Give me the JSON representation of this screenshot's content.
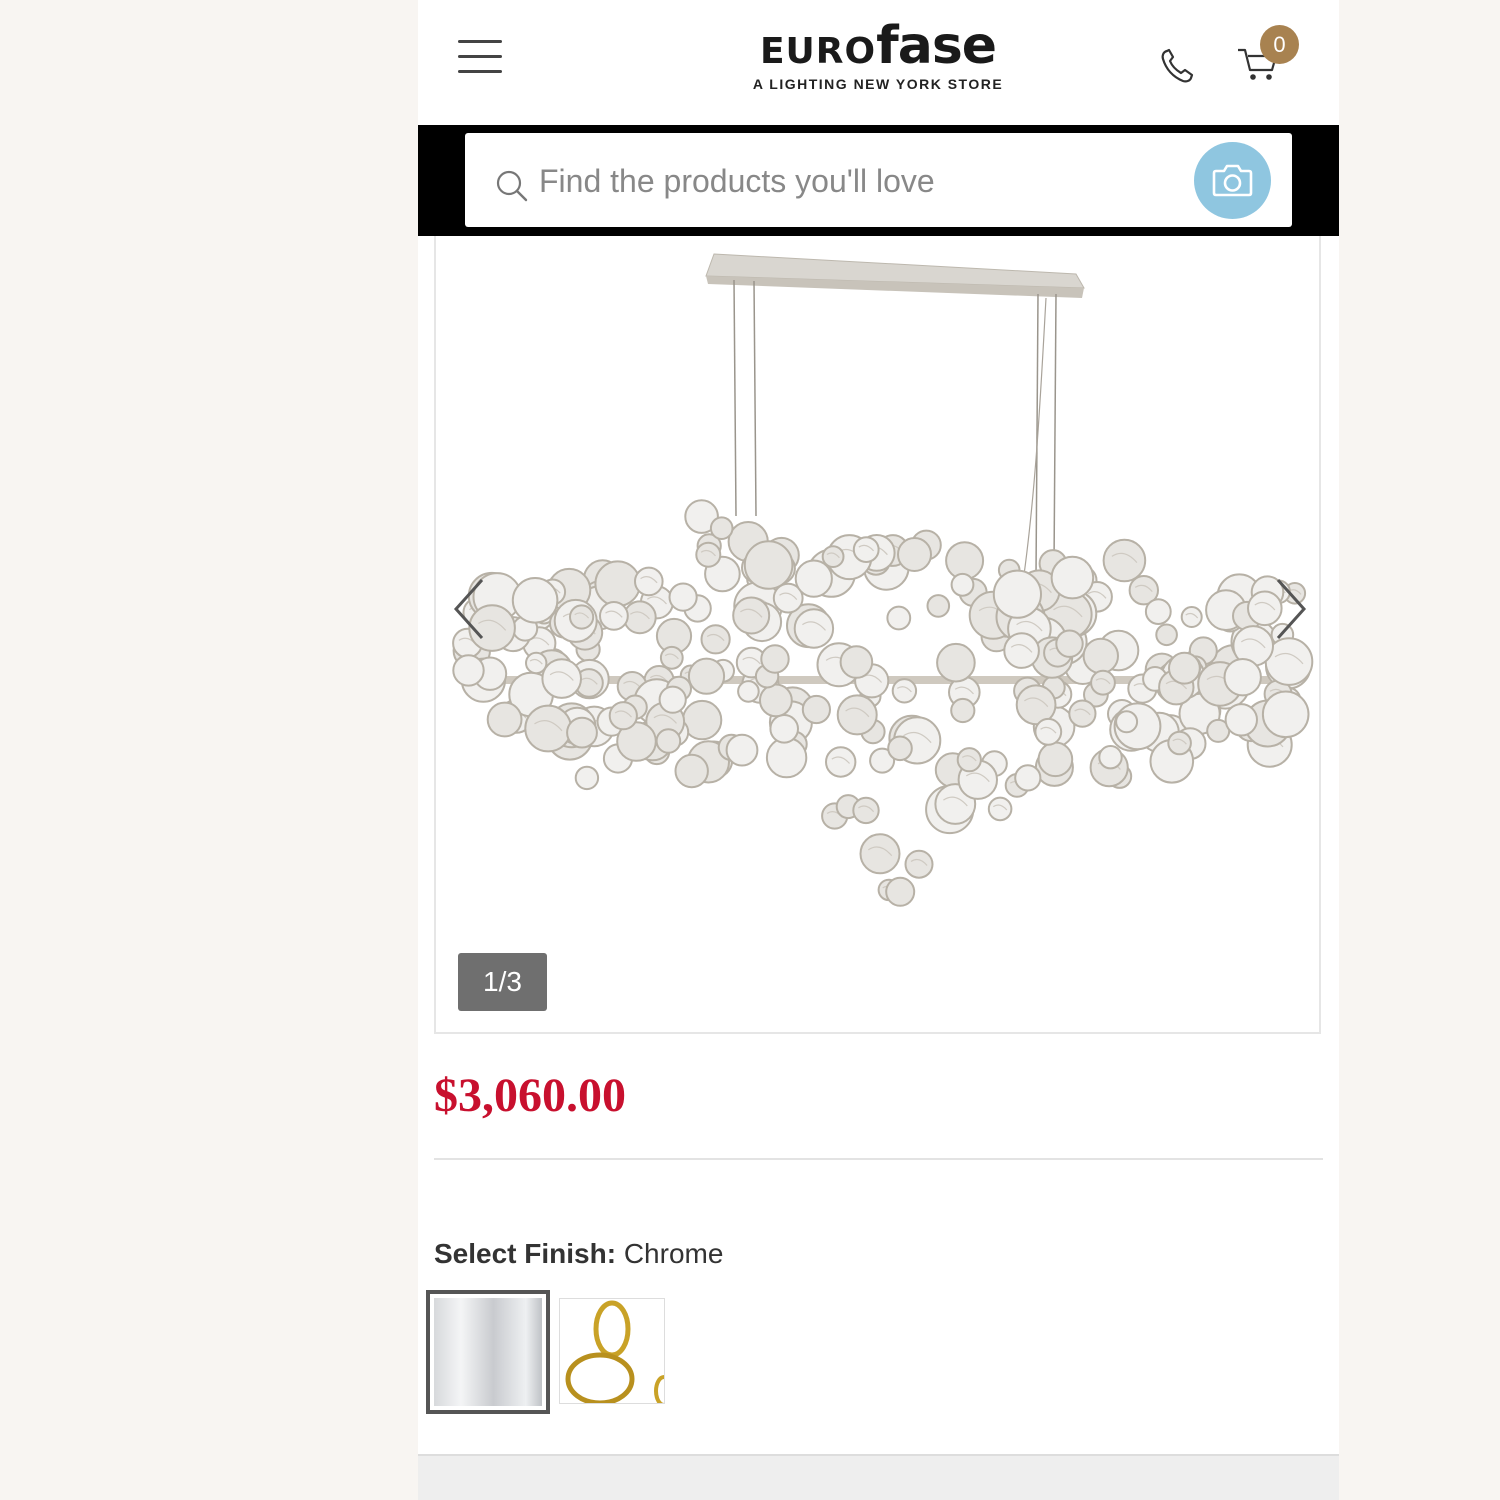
{
  "header": {
    "logo_euro": "EURO",
    "logo_fase": "fase",
    "tagline": "A LIGHTING NEW YORK STORE",
    "cart_count": "0",
    "icons": [
      "menu-icon",
      "phone-icon",
      "cart-icon"
    ]
  },
  "search": {
    "placeholder": "Find the products you'll love",
    "icons": [
      "search-icon",
      "camera-icon"
    ]
  },
  "gallery": {
    "counter": "1/3",
    "current_image": 1,
    "total_images": 3
  },
  "product": {
    "price": "$3,060.00",
    "finish_label": "Select Finish:",
    "finish_value": "Chrome",
    "finish_options": [
      "Chrome",
      "Gold"
    ],
    "selected_finish": "Chrome"
  },
  "colors": {
    "price": "#c8102e",
    "cart_badge": "#a88250",
    "camera_button": "#8fc6e0",
    "search_bar_bg": "#000000"
  }
}
